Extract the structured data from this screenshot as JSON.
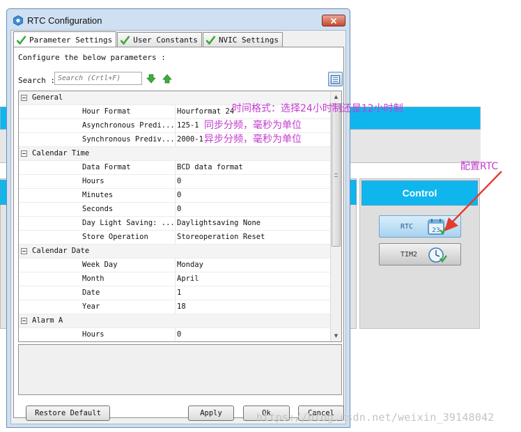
{
  "dialog": {
    "title": "RTC Configuration",
    "tabs": [
      {
        "label": "Parameter Settings",
        "active": true
      },
      {
        "label": "User Constants",
        "active": false
      },
      {
        "label": "NVIC Settings",
        "active": false
      }
    ],
    "configure_text": "Configure the below parameters :",
    "search_label": "Search :",
    "search_placeholder": "Search (Crtl+F)",
    "groups": {
      "general": {
        "title": "General",
        "rows": [
          {
            "name": "Hour Format",
            "value": "Hourformat 24"
          },
          {
            "name": "Asynchronous Predi...",
            "value": "125-1"
          },
          {
            "name": "Synchronous Prediv...",
            "value": "2000-1"
          }
        ]
      },
      "calendar_time": {
        "title": "Calendar Time",
        "rows": [
          {
            "name": "Data Format",
            "value": "BCD data format"
          },
          {
            "name": "Hours",
            "value": "0"
          },
          {
            "name": "Minutes",
            "value": "0"
          },
          {
            "name": "Seconds",
            "value": "0"
          },
          {
            "name": "Day Light Saving: ...",
            "value": "Daylightsaving None"
          },
          {
            "name": "Store Operation",
            "value": "Storeoperation Reset"
          }
        ]
      },
      "calendar_date": {
        "title": "Calendar Date",
        "rows": [
          {
            "name": "Week Day",
            "value": "Monday"
          },
          {
            "name": "Month",
            "value": "April"
          },
          {
            "name": "Date",
            "value": "1"
          },
          {
            "name": "Year",
            "value": "18"
          }
        ]
      },
      "alarm_a": {
        "title": "Alarm A",
        "rows": [
          {
            "name": "Hours",
            "value": "0"
          }
        ]
      }
    },
    "buttons": {
      "restore_default": "Restore Default",
      "apply": "Apply",
      "ok": "Ok",
      "cancel": "Cancel"
    }
  },
  "background": {
    "control_title": "Control",
    "ip_buttons": [
      {
        "label": "RTC",
        "icon": "calendar-icon",
        "calendar_day": "23"
      },
      {
        "label": "TIM2",
        "icon": "clock-icon"
      }
    ]
  },
  "annotations": {
    "hour_format_note": "时间格式：选择24小时制还是12小时制",
    "async_note": "同步分频，毫秒为单位",
    "sync_note": "异步分频，毫秒为单位",
    "config_rtc": "配置RTC"
  },
  "watermark": "https://blog.csdn.net/weixin_39148042",
  "colors": {
    "accent_blue": "#0fb6ee",
    "annotation": "#c43ad0",
    "arrow": "#e53b2c",
    "dialog_frame": "#cfe0f3"
  }
}
